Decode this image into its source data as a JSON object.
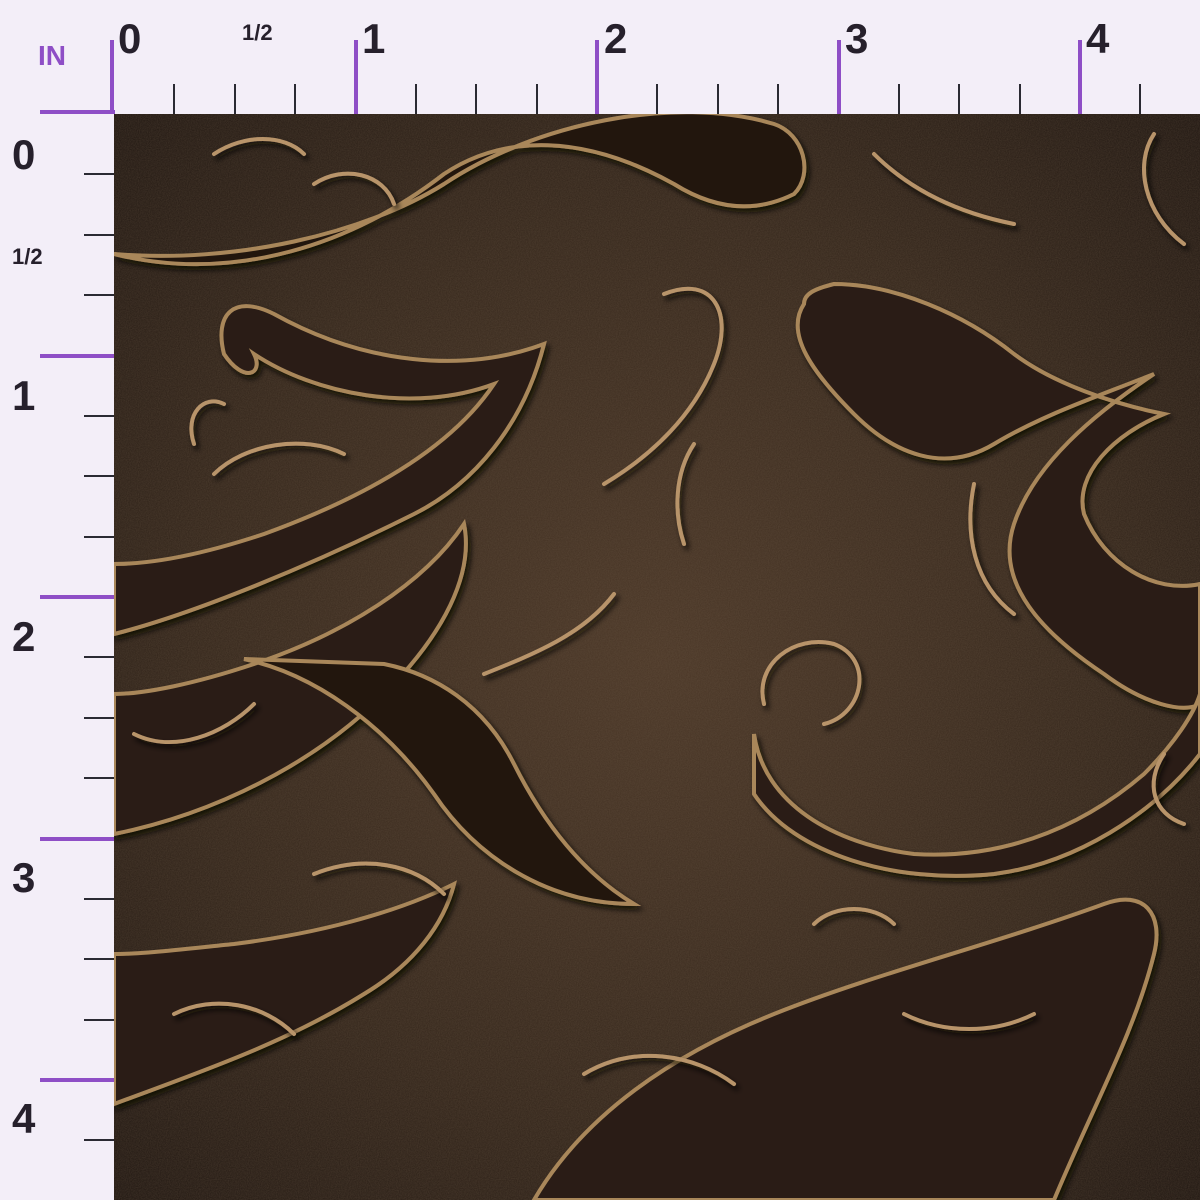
{
  "ruler": {
    "unit_label": "IN",
    "top_labels": [
      "0",
      "1/2",
      "1",
      "2",
      "3",
      "4"
    ],
    "left_labels": [
      "0",
      "1/2",
      "1",
      "2",
      "3",
      "4"
    ],
    "major_color": "#8e4ec6",
    "minor_color": "#2a2a33"
  },
  "swatch": {
    "pattern": "embossed dark brown leather with raised gold-edged swirling leaf flourishes",
    "base_color": "#2e2118",
    "highlight_color": "#b08a5a",
    "shadow_color": "#120c08"
  }
}
